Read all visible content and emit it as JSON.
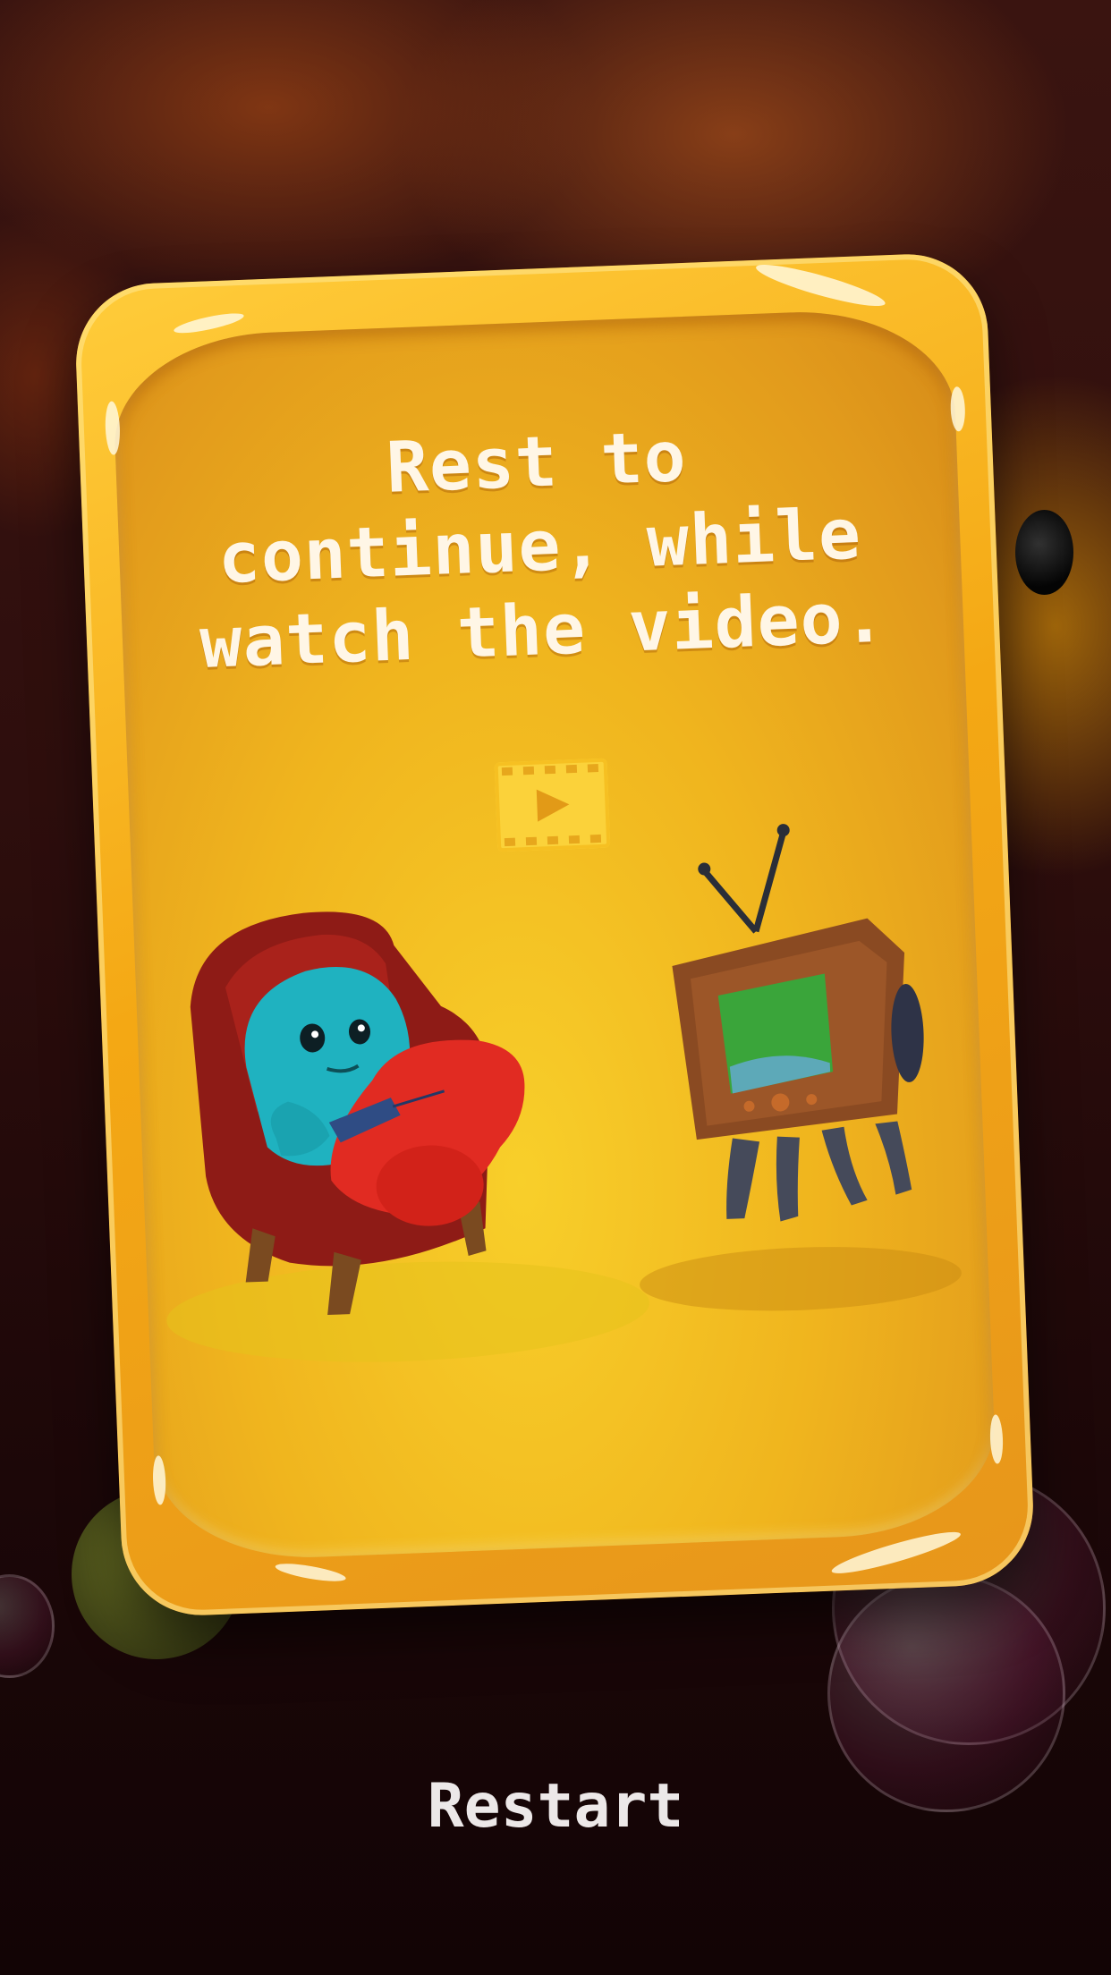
{
  "dialog": {
    "message": "Rest to continue, while watch the video.",
    "video_icon": "film-play-icon"
  },
  "footer": {
    "restart_label": "Restart"
  },
  "colors": {
    "card": "#f4a814",
    "card_highlight": "#ffcc3a",
    "text": "#fff6e6",
    "restart_text": "#ece8e8"
  }
}
